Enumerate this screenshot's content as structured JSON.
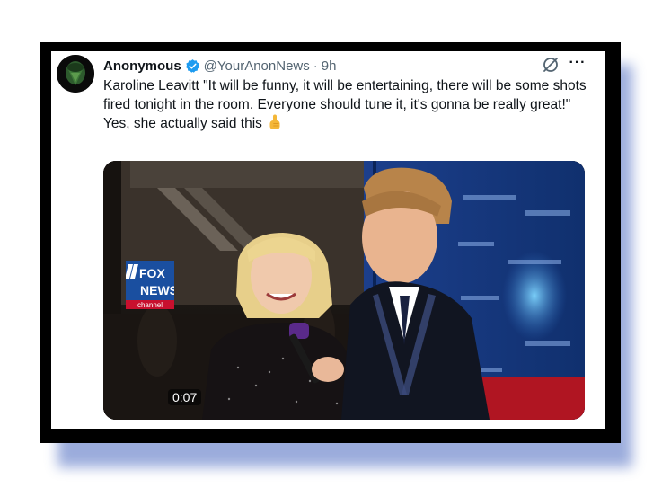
{
  "tweet": {
    "author_name": "Anonymous",
    "handle": "@YourAnonNews",
    "separator": "·",
    "time": "9h",
    "text_line1": "Karoline Leavitt \"It will be funny, it will be entertaining, there will be some shots fired tonight in the room. Everyone should tune it, it's gonna be really great!\"",
    "text_line2": "Yes, she actually said this"
  },
  "video": {
    "timestamp": "0:07",
    "logo_text_top": "FOX",
    "logo_text_bottom": "NEWS",
    "logo_channel": "channel"
  },
  "colors": {
    "verified": "#1d9bf0",
    "secondary_text": "#536471",
    "primary_text": "#0f1419",
    "shadow": "#8a9ed6",
    "logo_blue": "#1a4fa0",
    "logo_red": "#c8102e"
  },
  "icons": {
    "verified": "verified-badge-icon",
    "grok": "grok-icon",
    "more": "more-options-icon",
    "emoji": "pointing-up-emoji"
  }
}
